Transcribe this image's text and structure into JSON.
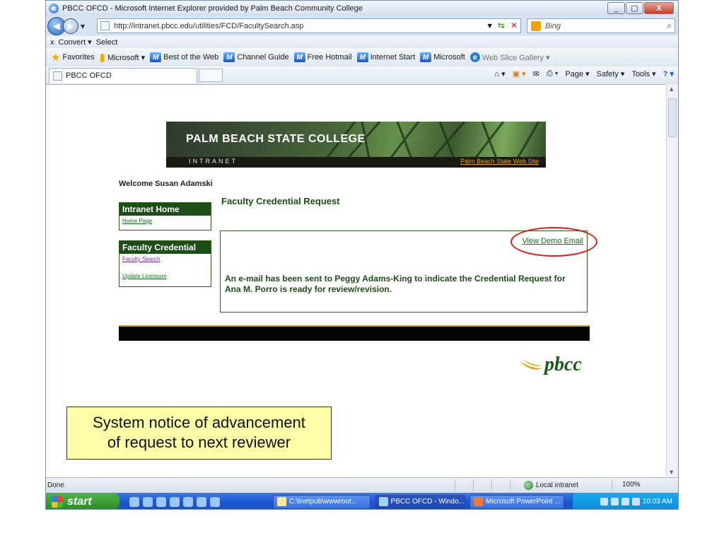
{
  "window": {
    "title": "PBCC OFCD - Microsoft Internet Explorer provided by Palm Beach Community College",
    "btn_minimize": "_",
    "btn_restore": "▢",
    "btn_close": "X"
  },
  "address_bar": {
    "url": "http://intranet.pbcc.edu/utilities/FCD/FacultySearch.asp",
    "search_placeholder": "Bing"
  },
  "convert_bar": {
    "close": "x",
    "convert": "Convert ▾",
    "select": "Select"
  },
  "favorites_bar": {
    "favorites": "Favorites",
    "items": [
      "Microsoft ▾",
      "Best of the Web",
      "Channel Guide",
      "Free Hotmail",
      "Internet Start",
      "Microsoft",
      "Web Slice Gallery ▾"
    ]
  },
  "tab": {
    "label": "PBCC OFCD"
  },
  "command_bar": {
    "page": "Page ▾",
    "safety": "Safety ▾",
    "tools": "Tools ▾"
  },
  "banner": {
    "college_name": "PALM BEACH STATE COLLEGE",
    "intranet": "INTRANET",
    "web_site_link": "Palm Beach State Web Site"
  },
  "page": {
    "welcome": "Welcome Susan Adamski",
    "title": "Faculty Credential Request",
    "nav": [
      {
        "heading": "Intranet Home",
        "links": [
          "Home Page"
        ]
      },
      {
        "heading": "Faculty Credential",
        "links": [
          "Faculty Search",
          "Update Licensure"
        ]
      }
    ],
    "view_demo_email": "View Demo Email",
    "message": "An e-mail has been sent to Peggy Adams-King to indicate the Credential Request for Ana M. Porro is ready for review/revision.",
    "logo_text": "pbcc"
  },
  "callout": {
    "line1": "System notice of advancement",
    "line2": "of request to next reviewer"
  },
  "status_bar": {
    "status": "Done",
    "zone": "Local intranet",
    "zoom": "100%"
  },
  "taskbar": {
    "start": "start",
    "tasks": [
      "C:\\Inetpub\\wwwroot...",
      "PBCC OFCD - Windo...",
      "Microsoft PowerPoint ..."
    ],
    "clock": "10:03 AM"
  }
}
